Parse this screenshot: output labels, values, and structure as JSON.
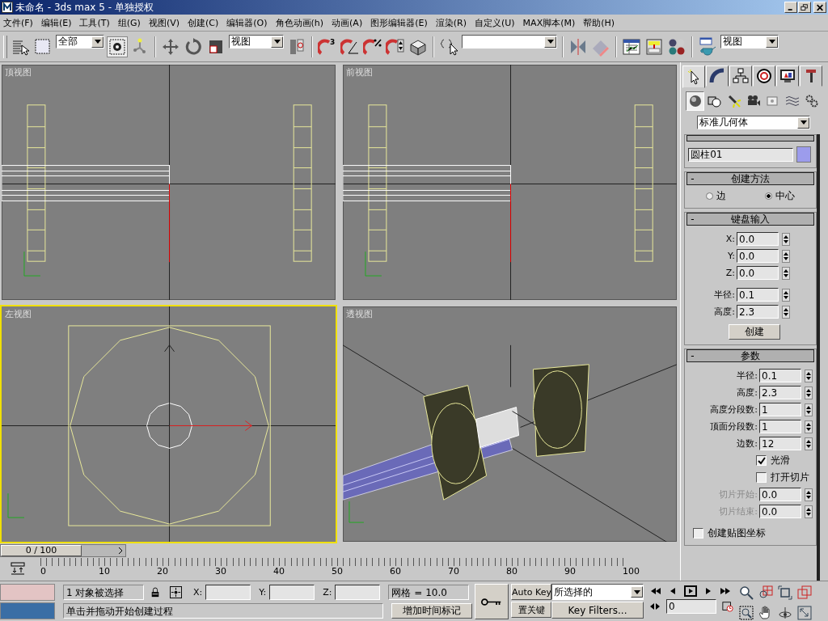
{
  "window": {
    "title": "未命名 - 3ds max 5 - 单独授权"
  },
  "menu": [
    "文件(F)",
    "编辑(E)",
    "工具(T)",
    "组(G)",
    "视图(V)",
    "创建(C)",
    "编辑器(O)",
    "角色动画(h)",
    "动画(A)",
    "图形编辑器(E)",
    "渲染(R)",
    "自定义(U)",
    "MAX脚本(M)",
    "帮助(H)"
  ],
  "toolbar": {
    "snap_dimension": "3",
    "selection_filter": "全部",
    "coord_system": "视图",
    "render_type": "视图"
  },
  "viewports": [
    {
      "label": "顶视图",
      "kind": "top",
      "selected": false
    },
    {
      "label": "前视图",
      "kind": "front",
      "selected": false
    },
    {
      "label": "左视图",
      "kind": "left",
      "selected": true
    },
    {
      "label": "透视图",
      "kind": "perspective",
      "selected": false
    }
  ],
  "command_panel": {
    "tabs": [
      {
        "kind": "create",
        "selected": true
      },
      {
        "kind": "modify",
        "selected": false
      },
      {
        "kind": "hierarchy",
        "selected": false
      },
      {
        "kind": "motion",
        "selected": false
      },
      {
        "kind": "display",
        "selected": false
      },
      {
        "kind": "utilities",
        "selected": false
      }
    ],
    "categories": [
      {
        "kind": "geometry",
        "selected": true
      },
      {
        "kind": "shapes",
        "selected": false
      },
      {
        "kind": "lights",
        "selected": false
      },
      {
        "kind": "cameras",
        "selected": false
      },
      {
        "kind": "helpers",
        "selected": false
      },
      {
        "kind": "spacewarps",
        "selected": false
      },
      {
        "kind": "systems",
        "selected": false
      }
    ],
    "object_type": "标准几何体",
    "name_color": {
      "name": "圆柱01",
      "color": "#9c9cec"
    },
    "creation_method": {
      "toggle": "-",
      "title": "创建方法",
      "options": [
        {
          "label": "边",
          "selected": false
        },
        {
          "label": "中心",
          "selected": true
        }
      ]
    },
    "keyboard_entry": {
      "toggle": "-",
      "title": "键盘输入",
      "fields": [
        {
          "label": "X:",
          "value": "0.0"
        },
        {
          "label": "Y:",
          "value": "0.0"
        },
        {
          "label": "Z:",
          "value": "0.0"
        },
        {
          "label": "半径:",
          "value": "0.1"
        },
        {
          "label": "高度:",
          "value": "2.3"
        }
      ],
      "button": "创建"
    },
    "parameters": {
      "toggle": "-",
      "title": "参数",
      "fields": [
        {
          "label": "半径:",
          "value": "0.1",
          "disabled": false
        },
        {
          "label": "高度:",
          "value": "2.3",
          "disabled": false
        },
        {
          "label": "高度分段数:",
          "value": "1",
          "disabled": false
        },
        {
          "label": "顶面分段数:",
          "value": "1",
          "disabled": false
        },
        {
          "label": "边数:",
          "value": "12",
          "disabled": false
        },
        {
          "label": "光滑",
          "kind": "checkbox",
          "checked": true,
          "disabled": false
        },
        {
          "label": "打开切片",
          "kind": "checkbox",
          "checked": false,
          "disabled": false
        },
        {
          "label": "切片开始:",
          "value": "0.0",
          "disabled": true
        },
        {
          "label": "切片结束:",
          "value": "0.0",
          "disabled": true
        }
      ],
      "map_coords": {
        "label": "创建贴图坐标",
        "checked": false
      }
    }
  },
  "time_slider": {
    "label": "0 / 100",
    "level": 0
  },
  "ruler": [
    "0",
    "10",
    "20",
    "30",
    "40",
    "50",
    "60",
    "70",
    "80",
    "90",
    "100"
  ],
  "status": {
    "selection": "1 对象被选择",
    "x_label": "X:",
    "y_label": "Y:",
    "z_label": "Z:",
    "grid": "网格 = 10.0",
    "prompt": "单击并拖动开始创建过程",
    "add_time_tag": "增加时间标记",
    "auto_key": "Auto Key",
    "set_key": "置关键",
    "key_mode": "所选择的",
    "key_filters": "Key Filters...",
    "frame": "0"
  }
}
